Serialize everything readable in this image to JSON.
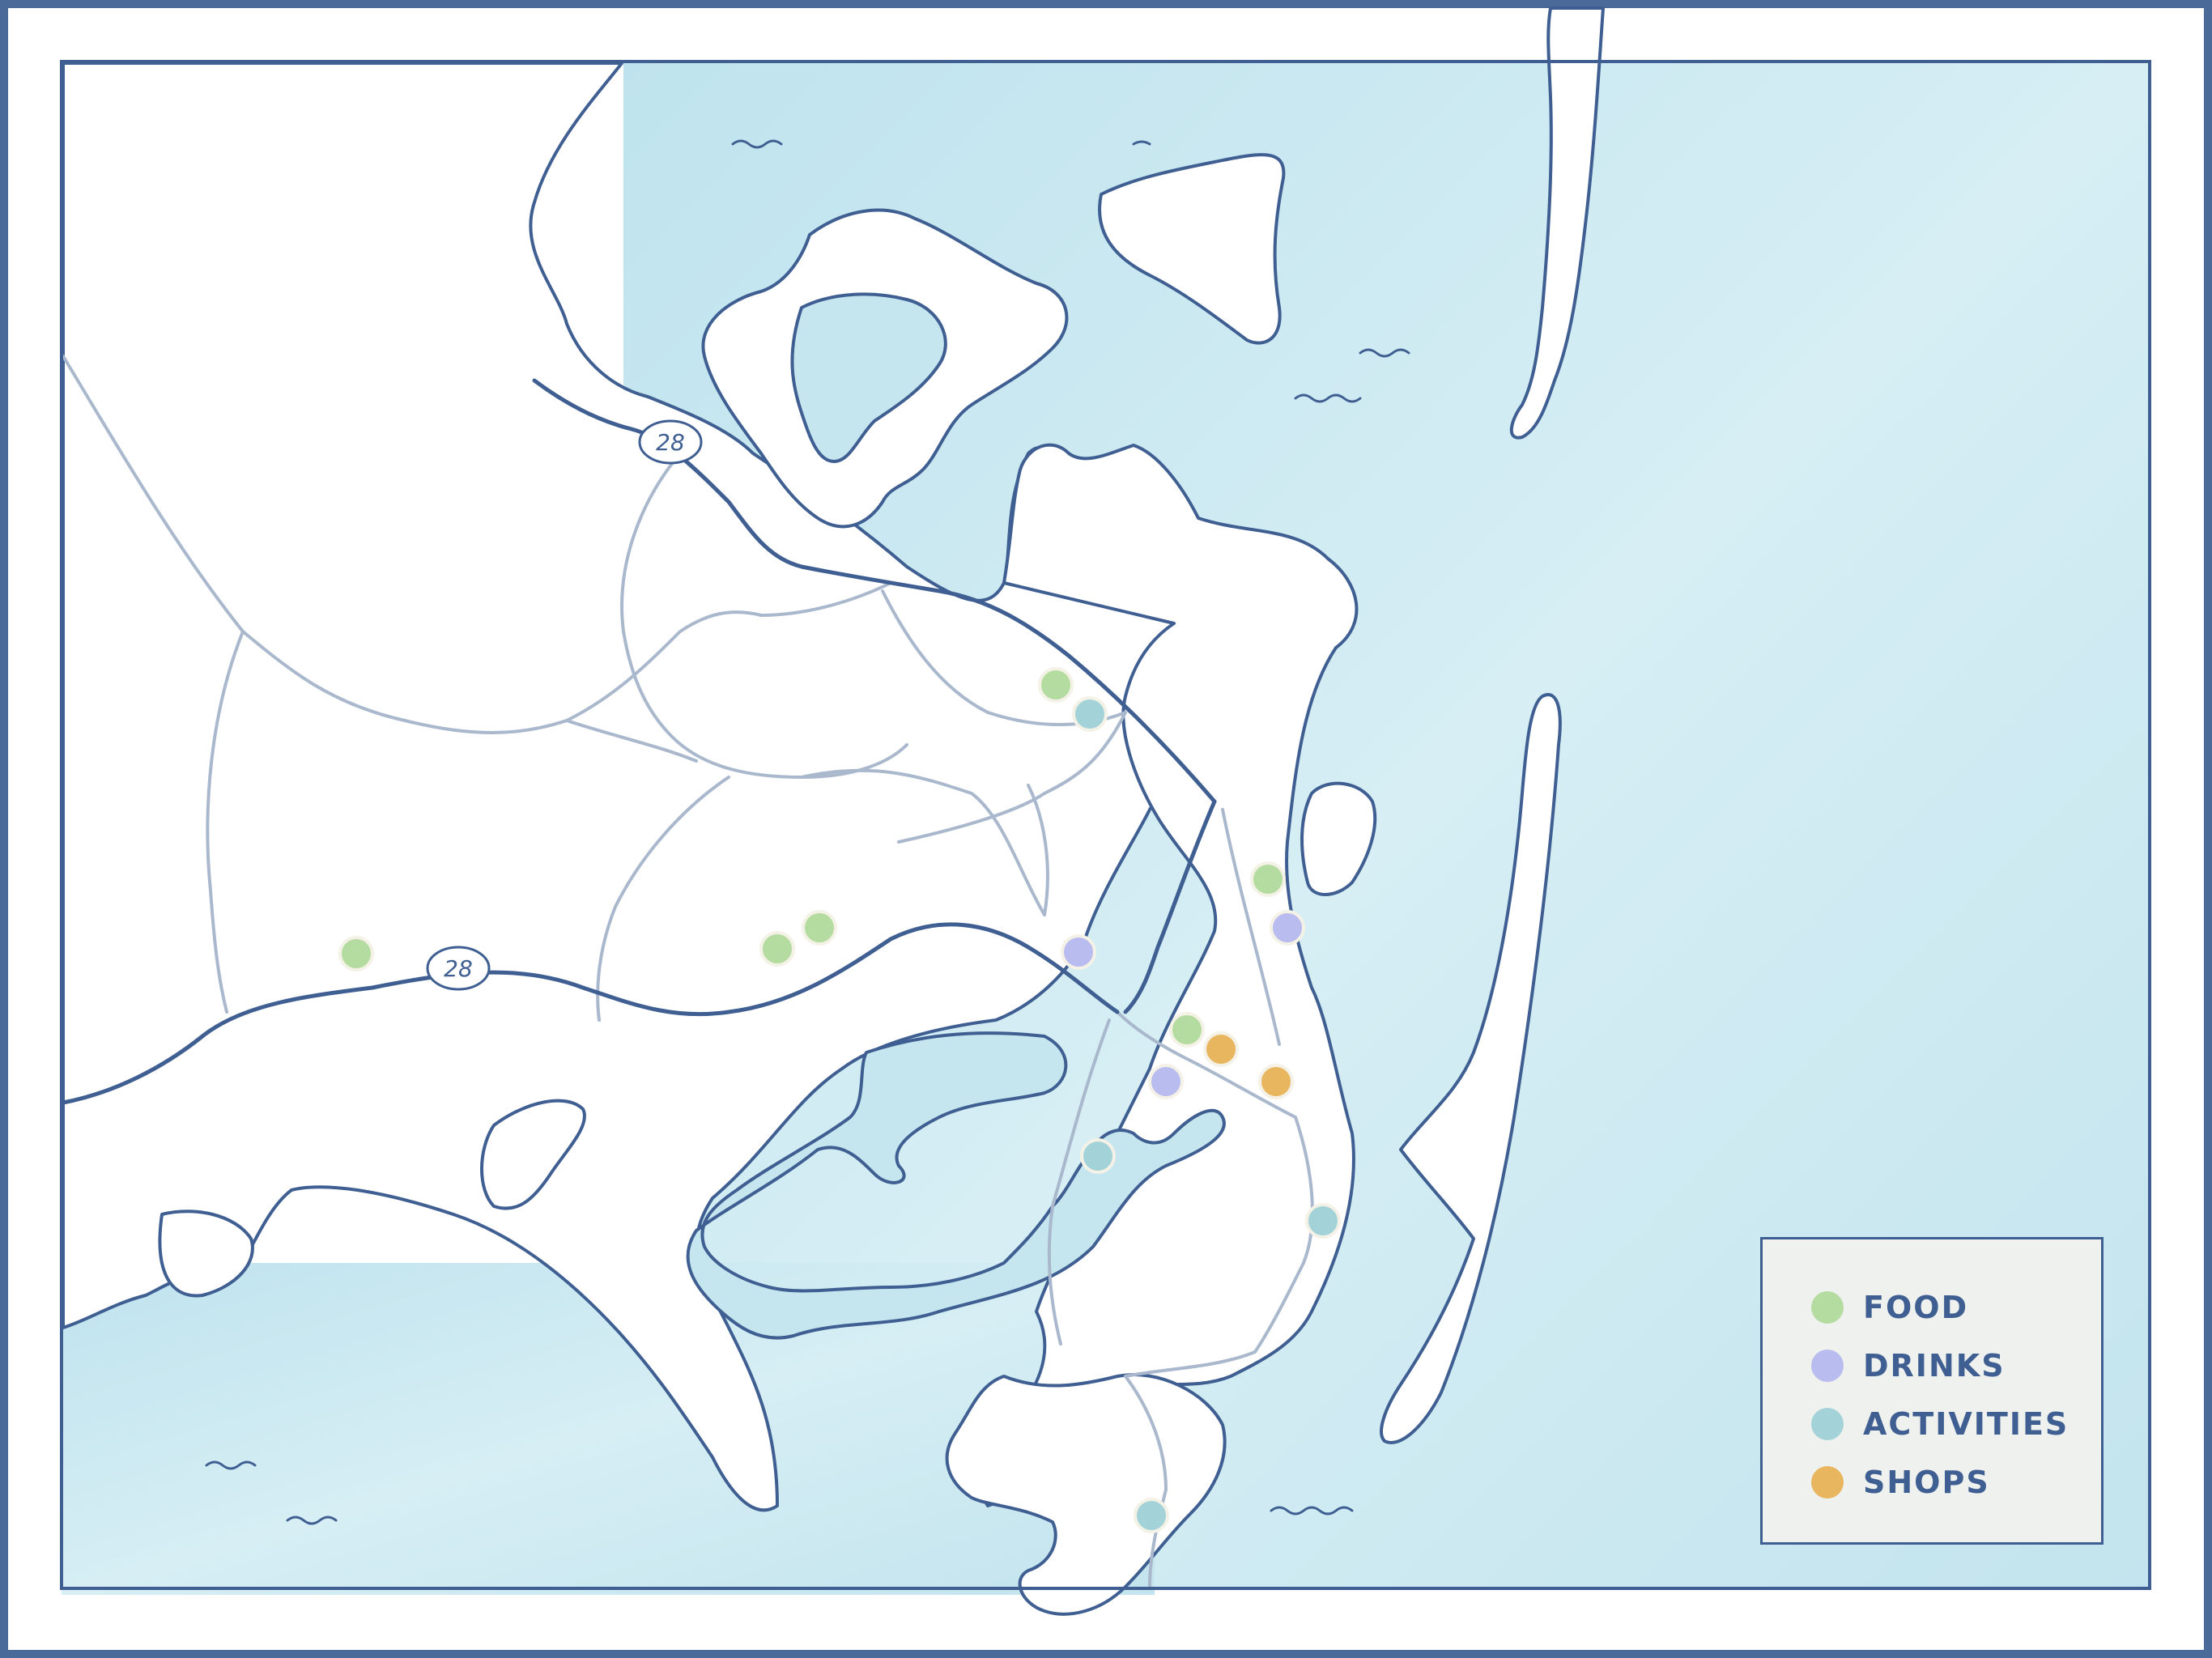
{
  "map": {
    "route_shields": [
      {
        "label": "28"
      },
      {
        "label": "28"
      }
    ],
    "colors": {
      "water": "#c6e6ef",
      "land": "#ffffff",
      "coast": "#3f5f92",
      "minor_road": "#a9b8cc",
      "food": "#b4dca0",
      "drinks": "#b9bcee",
      "activities": "#a3d3d8",
      "shops": "#e9b660"
    },
    "markers": [
      {
        "category": "food"
      },
      {
        "category": "activities"
      },
      {
        "category": "food"
      },
      {
        "category": "food"
      },
      {
        "category": "food"
      },
      {
        "category": "drinks"
      },
      {
        "category": "food"
      },
      {
        "category": "drinks"
      },
      {
        "category": "food"
      },
      {
        "category": "shops"
      },
      {
        "category": "drinks"
      },
      {
        "category": "shops"
      },
      {
        "category": "activities"
      },
      {
        "category": "activities"
      },
      {
        "category": "activities"
      }
    ]
  },
  "legend": {
    "items": [
      {
        "key": "food",
        "label": "FOOD",
        "color": "#b4dca0"
      },
      {
        "key": "drinks",
        "label": "DRINKS",
        "color": "#b9bcee"
      },
      {
        "key": "activities",
        "label": "ACTIVITIES",
        "color": "#a3d3d8"
      },
      {
        "key": "shops",
        "label": "SHOPS",
        "color": "#e9b660"
      }
    ]
  }
}
